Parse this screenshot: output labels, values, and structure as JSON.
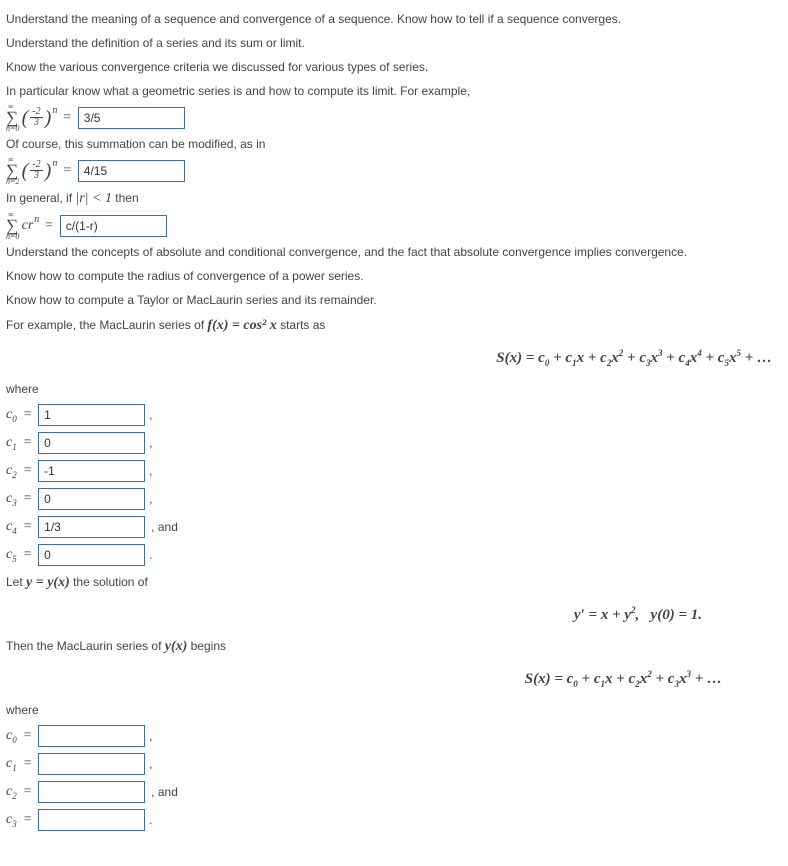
{
  "intro": {
    "p1": "Understand the meaning of a sequence and convergence of a sequence. Know how to tell if a sequence converges.",
    "p2": "Understand the definition of a series and its sum or limit.",
    "p3": "Know the various convergence criteria we discussed for various types of series.",
    "p4": "In particular know what a geometric series is and how to compute its limit. For example,"
  },
  "geom1": {
    "value": "3/5"
  },
  "p5": "Of course, this summation can be modified, as in",
  "geom2": {
    "value": "4/15"
  },
  "p6_pre": "In general, if ",
  "p6_mid": "|r| < 1",
  "p6_post": " then",
  "geom3": {
    "value": "c/(1-r)"
  },
  "p7": "Understand the concepts of absolute and conditional convergence, and the fact that absolute convergence implies convergence.",
  "p8": "Know how to compute the radius of convergence of a power series.",
  "p9": "Know how to compute a Taylor or MacLaurin series and its remainder.",
  "p10_pre": "For example, the MacLaurin series of ",
  "p10_mid": "f(x) = cos² x",
  "p10_post": " starts as",
  "series1_tex": "S(x) = c₀ + c₁x + c₂x² + c₃x³ + c₄x⁴ + c₅x⁵ + …",
  "where": "where",
  "coeffs1": {
    "c0": "1",
    "c1": "0",
    "c2": "-1",
    "c3": "0",
    "c4": "1/3",
    "c5": "0"
  },
  "punct": {
    "comma": ",",
    "and": ", and",
    "period": "."
  },
  "p11_pre": "Let ",
  "p11_mid": "y = y(x)",
  "p11_post": " the solution of",
  "ode_tex": "y′ = x + y²,    y(0) = 1.",
  "p12_pre": "Then the MacLaurin series of ",
  "p12_mid": "y(x)",
  "p12_post": " begins",
  "series2_tex": "S(x) = c₀ + c₁x + c₂x² + c₃x³ + …",
  "coeffs2": {
    "c0": "",
    "c1": "",
    "c2": "",
    "c3": ""
  }
}
